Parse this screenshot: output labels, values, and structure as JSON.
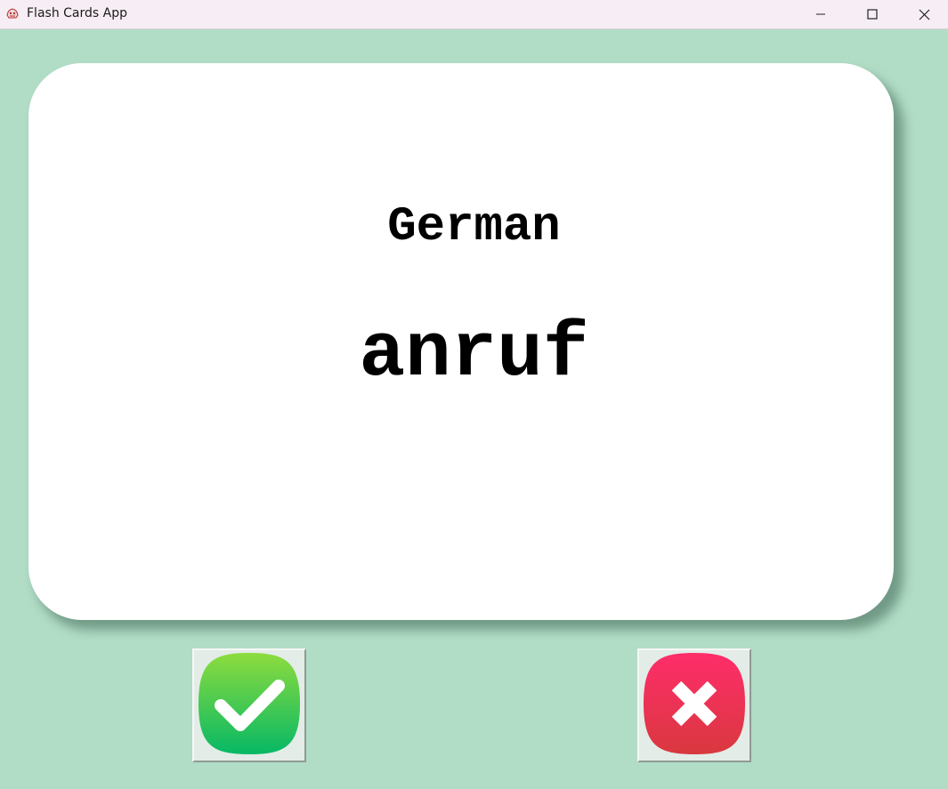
{
  "window": {
    "title": "Flash Cards App",
    "controls": {
      "minimize": "minimize-icon",
      "maximize": "maximize-icon",
      "close": "close-icon"
    }
  },
  "card": {
    "title": "German",
    "word": "anruf"
  },
  "actions": {
    "known": {
      "icon": "checkmark-icon",
      "color": "#1fbf5f"
    },
    "unknown": {
      "icon": "cross-icon",
      "color": "#e8354f"
    }
  },
  "colors": {
    "background": "#b1dcc6",
    "card": "#ffffff",
    "titlebar": "#f6eef4"
  }
}
